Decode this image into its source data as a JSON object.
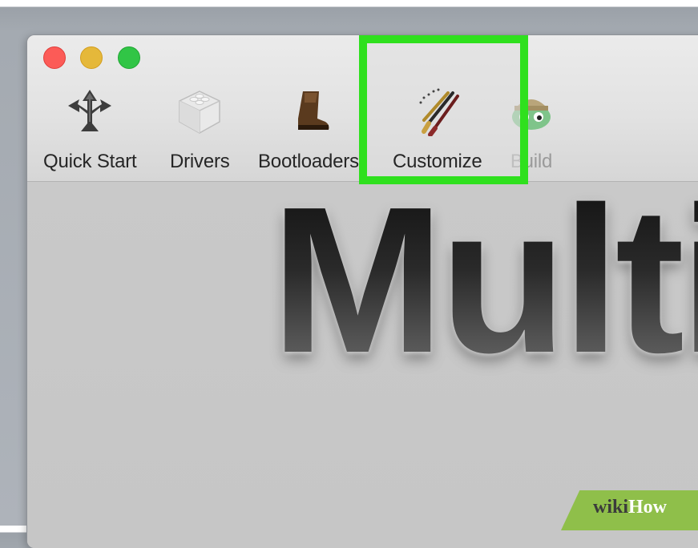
{
  "window": {
    "controls": [
      "close",
      "minimize",
      "zoom"
    ],
    "accent_colors": {
      "close": "#fc5b57",
      "minimize": "#e5b83a",
      "zoom": "#31c546",
      "highlight": "#2fe01e"
    }
  },
  "toolbar": {
    "items": [
      {
        "label": "Quick Start",
        "icon": "quick-start-icon"
      },
      {
        "label": "Drivers",
        "icon": "drivers-icon"
      },
      {
        "label": "Bootloaders",
        "icon": "boot-icon"
      },
      {
        "label": "Customize",
        "icon": "brushes-icon",
        "highlighted": true
      },
      {
        "label": "Build",
        "icon": "build-icon"
      }
    ]
  },
  "content": {
    "hero_text": "Multi"
  },
  "watermark": {
    "part1": "wiki",
    "part2": "How"
  }
}
